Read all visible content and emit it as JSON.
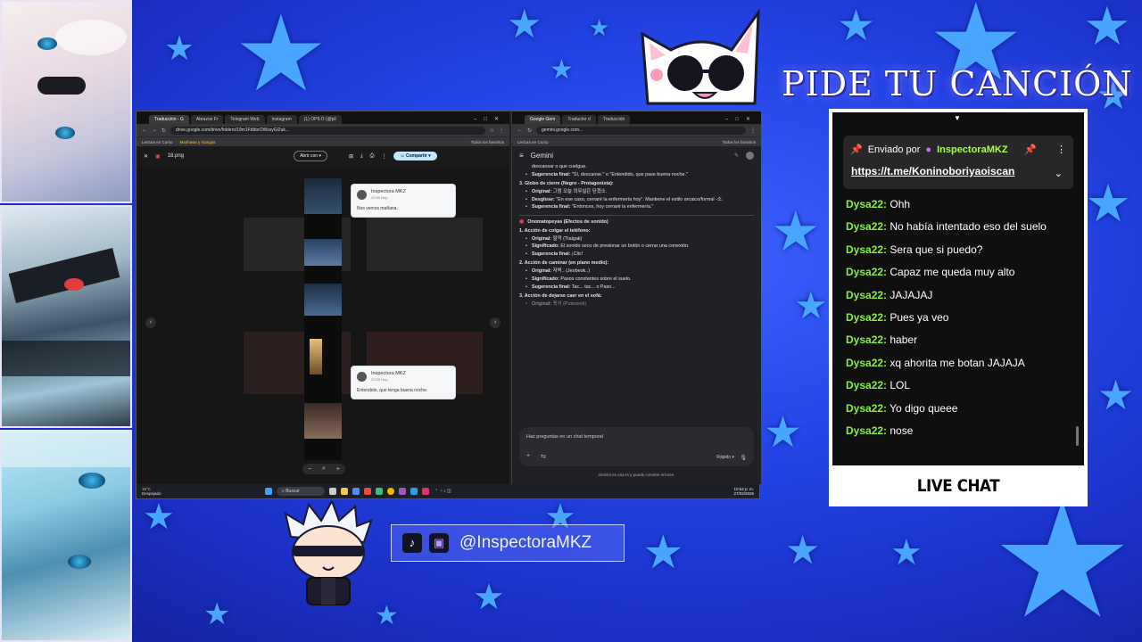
{
  "title": "PIDE TU CANCIÓN",
  "social_handle": "@InspectoraMKZ",
  "chat": {
    "pinned": {
      "label": "Enviado por",
      "author": "InspectoraMKZ",
      "link": "https://t.me/Koninoboriyaoiscan"
    },
    "messages": [
      {
        "author": "Dysa22:",
        "text": "Ohh"
      },
      {
        "author": "Dysa22:",
        "text": "No había intentado eso del suelo"
      },
      {
        "author": "Dysa22:",
        "text": "Sera que si puedo?"
      },
      {
        "author": "Dysa22:",
        "text": "Capaz me queda muy alto"
      },
      {
        "author": "Dysa22:",
        "text": "JAJAJAJ"
      },
      {
        "author": "Dysa22:",
        "text": "Pues ya veo"
      },
      {
        "author": "Dysa22:",
        "text": "haber"
      },
      {
        "author": "Dysa22:",
        "text": "xq ahorita me botan JAJAJA"
      },
      {
        "author": "Dysa22:",
        "text": "LOL"
      },
      {
        "author": "Dysa22:",
        "text": "Yo digo queee"
      },
      {
        "author": "Dysa22:",
        "text": "nose"
      }
    ],
    "footer": "LIVE CHAT"
  },
  "screen": {
    "left_window": {
      "tabs": [
        "Traducción - G",
        "Abrazos Fr",
        "Telegram Web",
        "Instagram",
        "(1) OPILO (@pil"
      ],
      "url": "drive.google.com/drive/folders/19m1FdbbrOWssyGl2uk...",
      "bookmarks": [
        "Lectura en Curso",
        "Manhwas y mangas"
      ],
      "bookmarks_right": "Todos los favoritos",
      "file_name": "18.png",
      "open_with": "Abrir con",
      "share": "Compartir",
      "bubble1": {
        "name": "Inspectora MKZ",
        "time": "22:50 Hoy",
        "text": "Nos vemos mañana."
      },
      "bubble2": {
        "name": "Inspectora MKZ",
        "time": "22:50 Hoy",
        "text": "Entendido, que tenga buena noche."
      }
    },
    "right_window": {
      "tabs": [
        "Google Gem",
        "Traductor d",
        "Traducción"
      ],
      "url": "gemini.google.com...",
      "bookmarks": [
        "Lectura en Curso"
      ],
      "bookmarks_right": "Todos los favoritos",
      "app_name": "Gemini",
      "lines": {
        "l1": "descansar o que cuelgue.",
        "l2_label": "Sugerencia final:",
        "l2_text": " \"Sí, descanse.\" o \"Entendido, que pase buena noche.\"",
        "h3": "3. Globo de cierre (Negro - Protagonista):",
        "l3_label": "Original:",
        "l3_text": " 그럼 오늘 의무실은 닫겠소.",
        "l4_label": "Desglose:",
        "l4_text": " \"En ese caso, cerraré la enfermería hoy\". Mantiene el estilo arcaico/formal -소.",
        "l5_label": "Sugerencia final:",
        "l5_text": " \"Entonces, hoy cerraré la enfermería.\"",
        "section": "Onomatopeyas (Efectos de sonido)",
        "h1": "1. Acción de colgar el teléfono:",
        "l6_label": "Original:",
        "l6_text": " 딸깍 (Ttalgak)",
        "l7_label": "Significado:",
        "l7_text": " El sonido seco de presionar un botón o cerrar una conexión.",
        "l8_label": "Sugerencia final:",
        "l8_text": " ¡Clic!",
        "h2": "2. Acción de caminar (en plano medio):",
        "l9_label": "Original:",
        "l9_text": " 저벅.. (Jeobeok..)",
        "l10_label": "Significado:",
        "l10_text": " Pasos constantes sobre el suelo.",
        "l11_label": "Sugerencia final:",
        "l11_text": " Tac... tac... o Paso...",
        "h4": "3. Acción de dejarse caer en el sofá:",
        "l12_label": "Original:",
        "l12_text": " 푹석 (Puteseok)"
      },
      "input_placeholder": "Haz preguntas en un chat temporal",
      "mode": "Rápido",
      "disclaimer": "Gemini es una IA y puede cometer errores."
    },
    "taskbar": {
      "temp": "18°C",
      "weather": "Despejado",
      "search": "Buscar",
      "time": "10:54 p. m.",
      "date": "27/02/2026"
    }
  },
  "colors": {
    "background": "#2546e8",
    "chat_author": "#86f23b",
    "pinned_author": "#a8ff4d",
    "stars": "#49a6ff"
  }
}
